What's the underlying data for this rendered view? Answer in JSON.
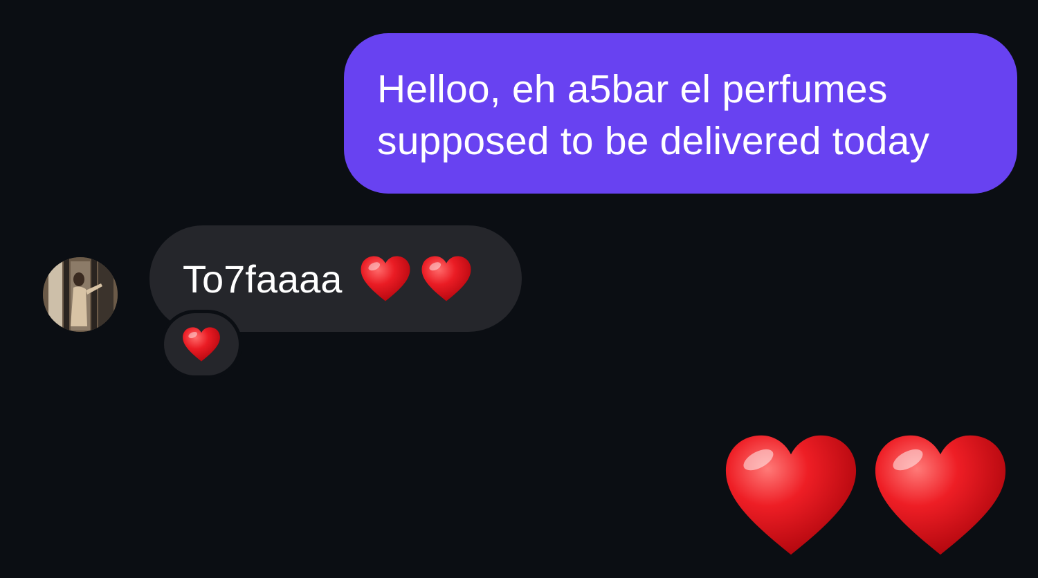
{
  "conversation": {
    "outgoing_message": {
      "line1": "Helloo, eh a5bar el perfumes",
      "line2": "supposed to be delivered today",
      "bubble_color": "#6842f1"
    },
    "incoming_message": {
      "text": "To7faaaa",
      "emoji": [
        "red-heart",
        "red-heart"
      ],
      "bubble_color": "#25262b",
      "reaction": "red-heart"
    },
    "sent_emoji": [
      "red-heart",
      "red-heart"
    ]
  },
  "theme": {
    "background": "#0b0e13",
    "heart_color": "#e8141f"
  }
}
